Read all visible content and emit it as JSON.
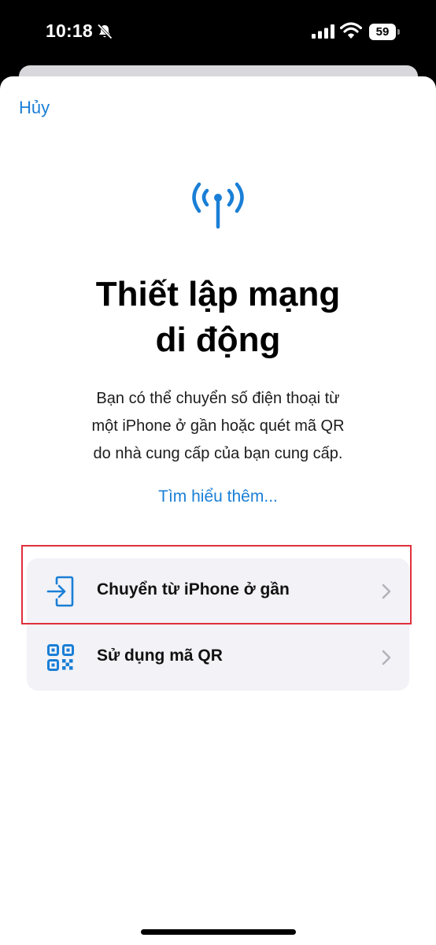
{
  "status_bar": {
    "time": "10:18",
    "battery": "59"
  },
  "sheet": {
    "cancel_label": "Hủy",
    "title_line1": "Thiết lập mạng",
    "title_line2": "di động",
    "description_line1": "Bạn có thể chuyển số điện thoại từ",
    "description_line2": "một iPhone ở gần hoặc quét mã QR",
    "description_line3": "do nhà cung cấp của bạn cung cấp.",
    "learn_more": "Tìm hiểu thêm...",
    "options": [
      {
        "label": "Chuyển từ iPhone ở gần",
        "icon": "transfer-icon"
      },
      {
        "label": "Sử dụng mã QR",
        "icon": "qr-code-icon"
      }
    ]
  },
  "colors": {
    "accent": "#1a7fd6",
    "highlight": "#e0303d",
    "group_background": "#f2f2f7"
  }
}
